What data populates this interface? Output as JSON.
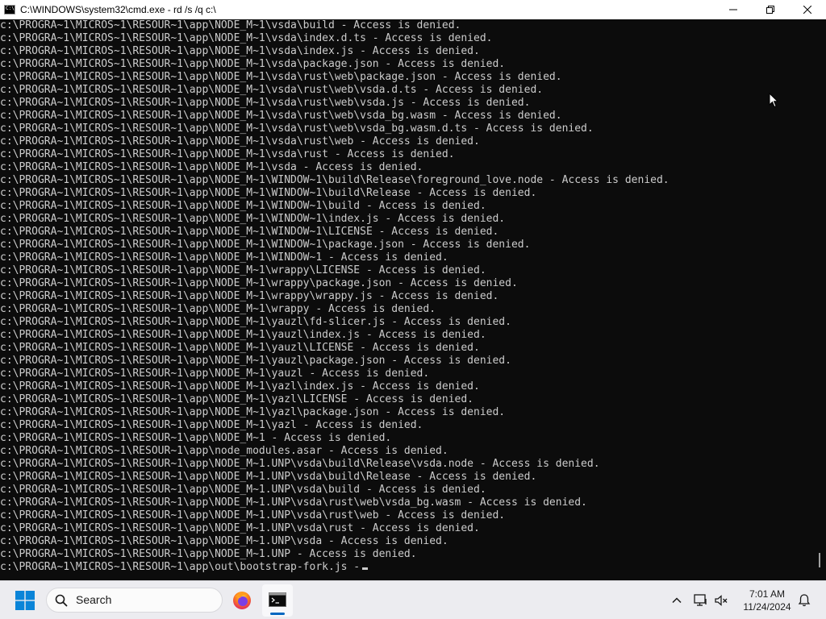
{
  "window": {
    "title": "C:\\WINDOWS\\system32\\cmd.exe - rd  /s /q c:\\"
  },
  "console": {
    "lines": [
      "c:\\PROGRA~1\\MICROS~1\\RESOUR~1\\app\\NODE_M~1\\vsda\\build - Access is denied.",
      "c:\\PROGRA~1\\MICROS~1\\RESOUR~1\\app\\NODE_M~1\\vsda\\index.d.ts - Access is denied.",
      "c:\\PROGRA~1\\MICROS~1\\RESOUR~1\\app\\NODE_M~1\\vsda\\index.js - Access is denied.",
      "c:\\PROGRA~1\\MICROS~1\\RESOUR~1\\app\\NODE_M~1\\vsda\\package.json - Access is denied.",
      "c:\\PROGRA~1\\MICROS~1\\RESOUR~1\\app\\NODE_M~1\\vsda\\rust\\web\\package.json - Access is denied.",
      "c:\\PROGRA~1\\MICROS~1\\RESOUR~1\\app\\NODE_M~1\\vsda\\rust\\web\\vsda.d.ts - Access is denied.",
      "c:\\PROGRA~1\\MICROS~1\\RESOUR~1\\app\\NODE_M~1\\vsda\\rust\\web\\vsda.js - Access is denied.",
      "c:\\PROGRA~1\\MICROS~1\\RESOUR~1\\app\\NODE_M~1\\vsda\\rust\\web\\vsda_bg.wasm - Access is denied.",
      "c:\\PROGRA~1\\MICROS~1\\RESOUR~1\\app\\NODE_M~1\\vsda\\rust\\web\\vsda_bg.wasm.d.ts - Access is denied.",
      "c:\\PROGRA~1\\MICROS~1\\RESOUR~1\\app\\NODE_M~1\\vsda\\rust\\web - Access is denied.",
      "c:\\PROGRA~1\\MICROS~1\\RESOUR~1\\app\\NODE_M~1\\vsda\\rust - Access is denied.",
      "c:\\PROGRA~1\\MICROS~1\\RESOUR~1\\app\\NODE_M~1\\vsda - Access is denied.",
      "c:\\PROGRA~1\\MICROS~1\\RESOUR~1\\app\\NODE_M~1\\WINDOW~1\\build\\Release\\foreground_love.node - Access is denied.",
      "c:\\PROGRA~1\\MICROS~1\\RESOUR~1\\app\\NODE_M~1\\WINDOW~1\\build\\Release - Access is denied.",
      "c:\\PROGRA~1\\MICROS~1\\RESOUR~1\\app\\NODE_M~1\\WINDOW~1\\build - Access is denied.",
      "c:\\PROGRA~1\\MICROS~1\\RESOUR~1\\app\\NODE_M~1\\WINDOW~1\\index.js - Access is denied.",
      "c:\\PROGRA~1\\MICROS~1\\RESOUR~1\\app\\NODE_M~1\\WINDOW~1\\LICENSE - Access is denied.",
      "c:\\PROGRA~1\\MICROS~1\\RESOUR~1\\app\\NODE_M~1\\WINDOW~1\\package.json - Access is denied.",
      "c:\\PROGRA~1\\MICROS~1\\RESOUR~1\\app\\NODE_M~1\\WINDOW~1 - Access is denied.",
      "c:\\PROGRA~1\\MICROS~1\\RESOUR~1\\app\\NODE_M~1\\wrappy\\LICENSE - Access is denied.",
      "c:\\PROGRA~1\\MICROS~1\\RESOUR~1\\app\\NODE_M~1\\wrappy\\package.json - Access is denied.",
      "c:\\PROGRA~1\\MICROS~1\\RESOUR~1\\app\\NODE_M~1\\wrappy\\wrappy.js - Access is denied.",
      "c:\\PROGRA~1\\MICROS~1\\RESOUR~1\\app\\NODE_M~1\\wrappy - Access is denied.",
      "c:\\PROGRA~1\\MICROS~1\\RESOUR~1\\app\\NODE_M~1\\yauzl\\fd-slicer.js - Access is denied.",
      "c:\\PROGRA~1\\MICROS~1\\RESOUR~1\\app\\NODE_M~1\\yauzl\\index.js - Access is denied.",
      "c:\\PROGRA~1\\MICROS~1\\RESOUR~1\\app\\NODE_M~1\\yauzl\\LICENSE - Access is denied.",
      "c:\\PROGRA~1\\MICROS~1\\RESOUR~1\\app\\NODE_M~1\\yauzl\\package.json - Access is denied.",
      "c:\\PROGRA~1\\MICROS~1\\RESOUR~1\\app\\NODE_M~1\\yauzl - Access is denied.",
      "c:\\PROGRA~1\\MICROS~1\\RESOUR~1\\app\\NODE_M~1\\yazl\\index.js - Access is denied.",
      "c:\\PROGRA~1\\MICROS~1\\RESOUR~1\\app\\NODE_M~1\\yazl\\LICENSE - Access is denied.",
      "c:\\PROGRA~1\\MICROS~1\\RESOUR~1\\app\\NODE_M~1\\yazl\\package.json - Access is denied.",
      "c:\\PROGRA~1\\MICROS~1\\RESOUR~1\\app\\NODE_M~1\\yazl - Access is denied.",
      "c:\\PROGRA~1\\MICROS~1\\RESOUR~1\\app\\NODE_M~1 - Access is denied.",
      "c:\\PROGRA~1\\MICROS~1\\RESOUR~1\\app\\node_modules.asar - Access is denied.",
      "c:\\PROGRA~1\\MICROS~1\\RESOUR~1\\app\\NODE_M~1.UNP\\vsda\\build\\Release\\vsda.node - Access is denied.",
      "c:\\PROGRA~1\\MICROS~1\\RESOUR~1\\app\\NODE_M~1.UNP\\vsda\\build\\Release - Access is denied.",
      "c:\\PROGRA~1\\MICROS~1\\RESOUR~1\\app\\NODE_M~1.UNP\\vsda\\build - Access is denied.",
      "c:\\PROGRA~1\\MICROS~1\\RESOUR~1\\app\\NODE_M~1.UNP\\vsda\\rust\\web\\vsda_bg.wasm - Access is denied.",
      "c:\\PROGRA~1\\MICROS~1\\RESOUR~1\\app\\NODE_M~1.UNP\\vsda\\rust\\web - Access is denied.",
      "c:\\PROGRA~1\\MICROS~1\\RESOUR~1\\app\\NODE_M~1.UNP\\vsda\\rust - Access is denied.",
      "c:\\PROGRA~1\\MICROS~1\\RESOUR~1\\app\\NODE_M~1.UNP\\vsda - Access is denied.",
      "c:\\PROGRA~1\\MICROS~1\\RESOUR~1\\app\\NODE_M~1.UNP - Access is denied."
    ],
    "current_line": "c:\\PROGRA~1\\MICROS~1\\RESOUR~1\\app\\out\\bootstrap-fork.js -"
  },
  "taskbar": {
    "search_label": "Search",
    "apps": [
      {
        "name": "Firefox",
        "icon": "firefox-icon"
      },
      {
        "name": "Command Prompt",
        "icon": "terminal-icon",
        "active": true
      }
    ],
    "clock": {
      "time": "7:01 AM",
      "date": "11/24/2024"
    }
  },
  "colors": {
    "console_bg": "#0c0c0c",
    "console_text": "#cccccc",
    "taskbar_bg": "#ececf0",
    "accent": "#0067c0"
  }
}
